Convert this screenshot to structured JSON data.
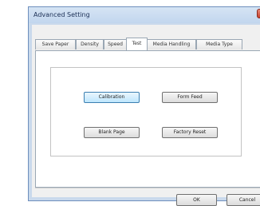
{
  "window": {
    "title": "Advanced Setting"
  },
  "tabs": [
    {
      "label": "Save Paper",
      "active": false
    },
    {
      "label": "Density",
      "active": false
    },
    {
      "label": "Speed",
      "active": false
    },
    {
      "label": "Test",
      "active": true
    },
    {
      "label": "Media Handling",
      "active": false
    },
    {
      "label": "Media Type",
      "active": false
    }
  ],
  "test_panel": {
    "calibration_label": "Calibration",
    "form_feed_label": "Form Feed",
    "blank_page_label": "Blank Page",
    "factory_reset_label": "Factory Reset"
  },
  "dialog_buttons": {
    "ok_label": "OK",
    "cancel_label": "Cancel"
  }
}
